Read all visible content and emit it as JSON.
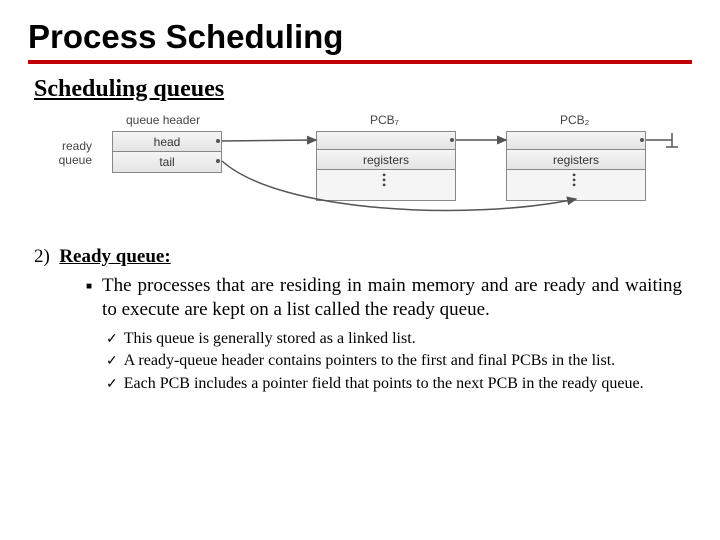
{
  "title": "Process Scheduling",
  "subtitle": "Scheduling queues",
  "diagram": {
    "queue_header_label": "queue header",
    "ready_queue_label_l1": "ready",
    "ready_queue_label_l2": "queue",
    "head_cell": "head",
    "tail_cell": "tail",
    "pcb7_label": "PCB₇",
    "pcb2_label": "PCB₂",
    "registers_cell": "registers"
  },
  "item_number": "2)",
  "item_heading": "Ready queue:",
  "bullet_text": "The processes that are residing in main memory and are ready and waiting to execute are kept on a list called the ready queue.",
  "checks": [
    "This queue is generally stored as a linked list.",
    "A ready-queue header contains pointers to the first and final PCBs in the list.",
    "Each PCB includes a pointer field that points to the next PCB in the ready queue."
  ]
}
